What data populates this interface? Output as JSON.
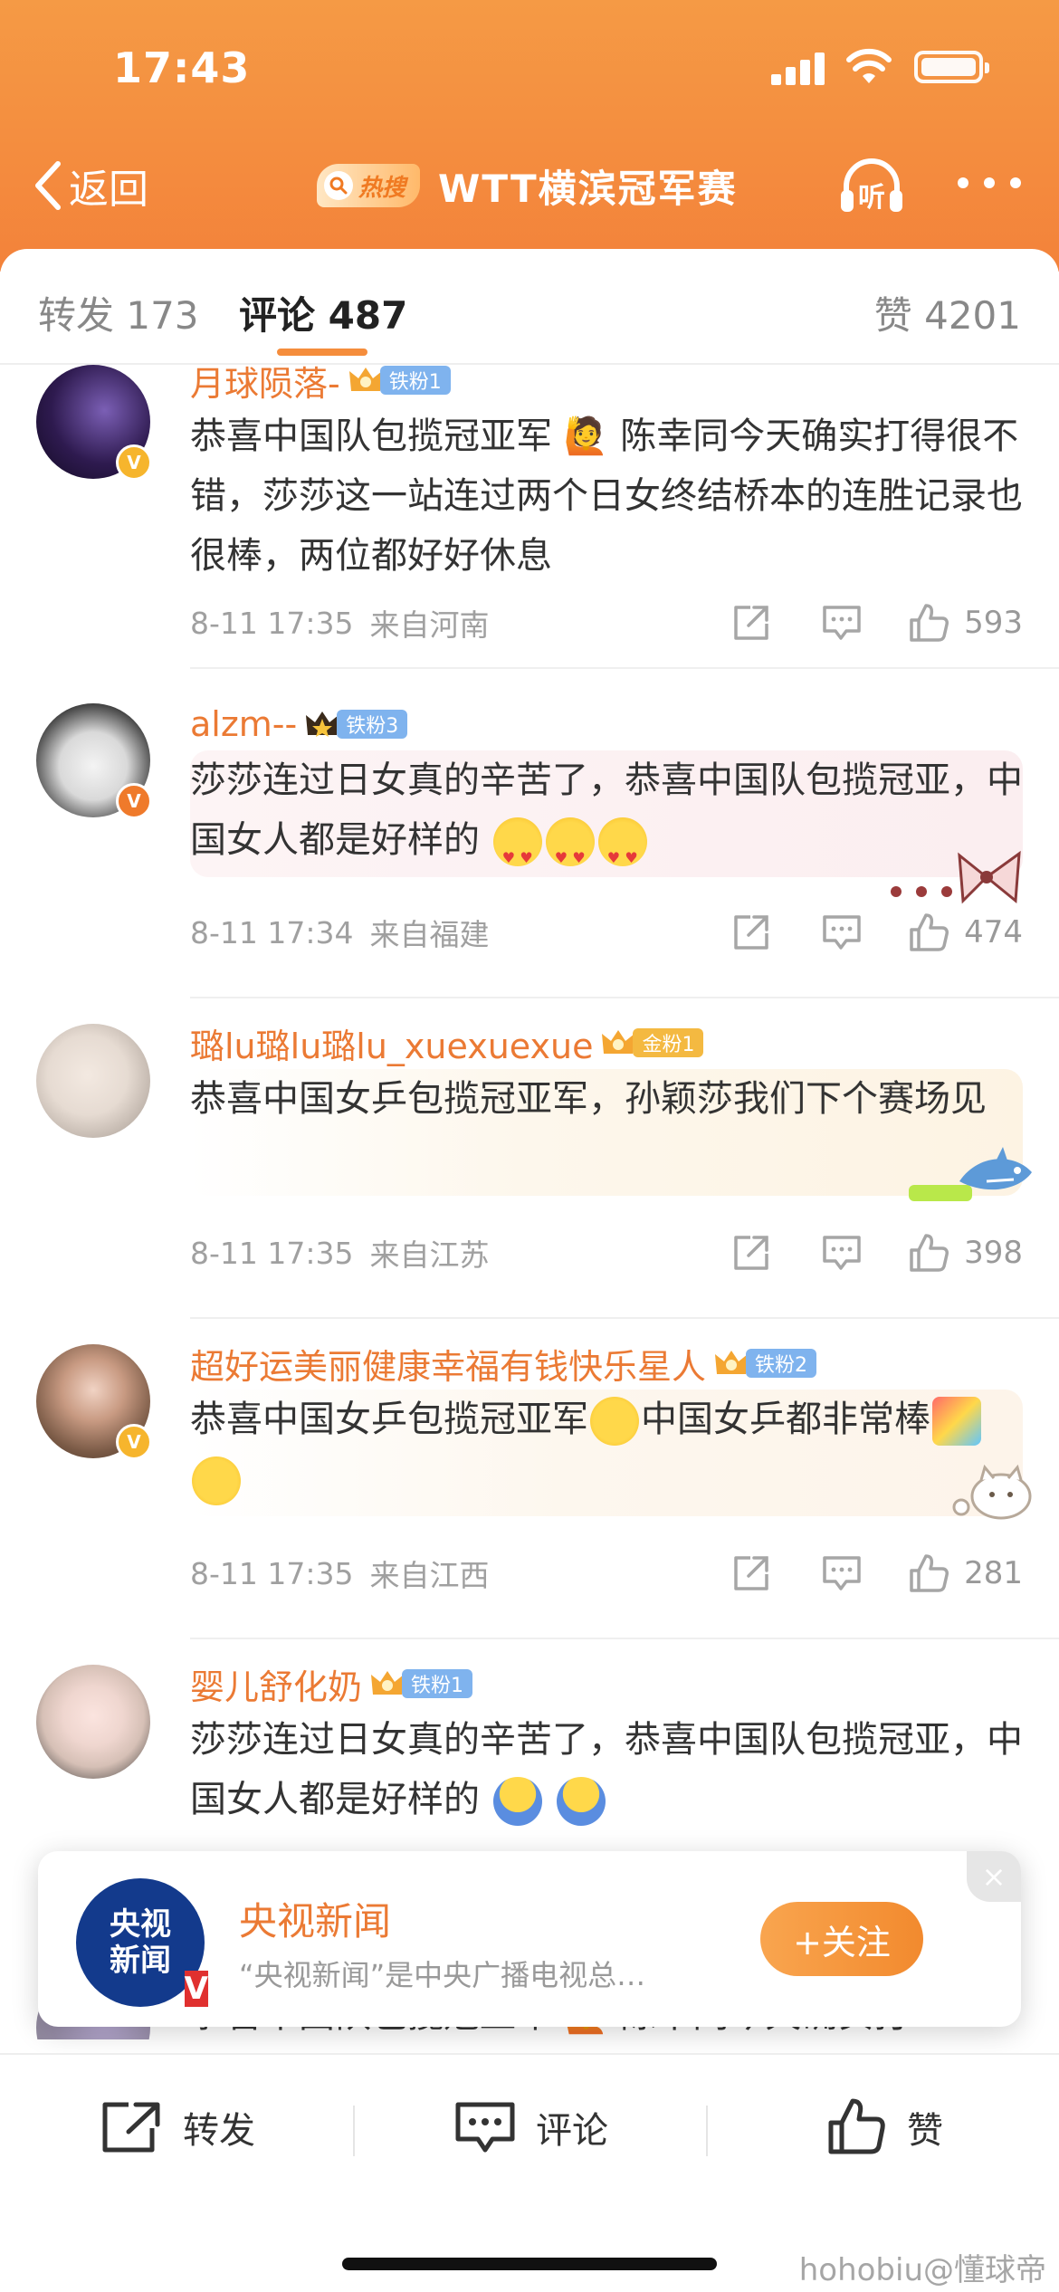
{
  "status_bar": {
    "time": "17:43"
  },
  "nav": {
    "back_label": "返回",
    "hot_label": "热搜",
    "title": "WTT横滨冠军赛",
    "listen_label": "听"
  },
  "tabs": [
    {
      "label": "转发 173"
    },
    {
      "label": "评论 487"
    },
    {
      "label": "赞 4201"
    }
  ],
  "comments": [
    {
      "username": "月球陨落-",
      "fan_badge": "铁粉1",
      "text": "恭喜中国队包揽冠亚军 🙋 陈幸同今天确实打得很不错，莎莎这一站连过两个日女终结桥本的连胜记录也很棒，两位都好好休息",
      "time": "8-11 17:35",
      "location": "来自河南",
      "likes": "593"
    },
    {
      "username": "alzm--",
      "fan_badge": "铁粉3",
      "text": "莎莎连过日女真的辛苦了，恭喜中国队包揽冠亚，中国女人都是好样的",
      "time": "8-11 17:34",
      "location": "来自福建",
      "likes": "474"
    },
    {
      "username": "璐lu璐lu璐lu_xuexuexue",
      "fan_badge": "金粉1",
      "text": "恭喜中国女乒包揽冠亚军，孙颖莎我们下个赛场见",
      "time": "8-11 17:35",
      "location": "来自江苏",
      "likes": "398"
    },
    {
      "username": "超好运美丽健康幸福有钱快乐星人",
      "fan_badge": "铁粉2",
      "text_a": "恭喜中国女乒包揽冠亚军",
      "text_b": "中国女乒都非常棒",
      "time": "8-11 17:35",
      "location": "来自江西",
      "likes": "281"
    },
    {
      "username": "婴儿舒化奶",
      "fan_badge": "铁粉1",
      "text": "莎莎连过日女真的辛苦了，恭喜中国队包揽冠亚，中国女人都是好样的",
      "peek_text": "恭喜中国队包揽冠亚军 🙋 陈幸同今天确实打"
    }
  ],
  "promo_card": {
    "logo_line1": "央视",
    "logo_line2": "新闻",
    "name": "央视新闻",
    "description": "“央视新闻”是中央广播电视总…",
    "follow_label": "+关注",
    "close_label": "×"
  },
  "bottom_bar": {
    "repost_label": "转发",
    "comment_label": "评论",
    "like_label": "赞"
  },
  "watermark": "hohobiu@懂球帝",
  "colors": {
    "accent": "#f3823a",
    "username": "#eb7a34",
    "iron_fan": "#7fb3ee",
    "gold_fan": "#f4b941"
  }
}
